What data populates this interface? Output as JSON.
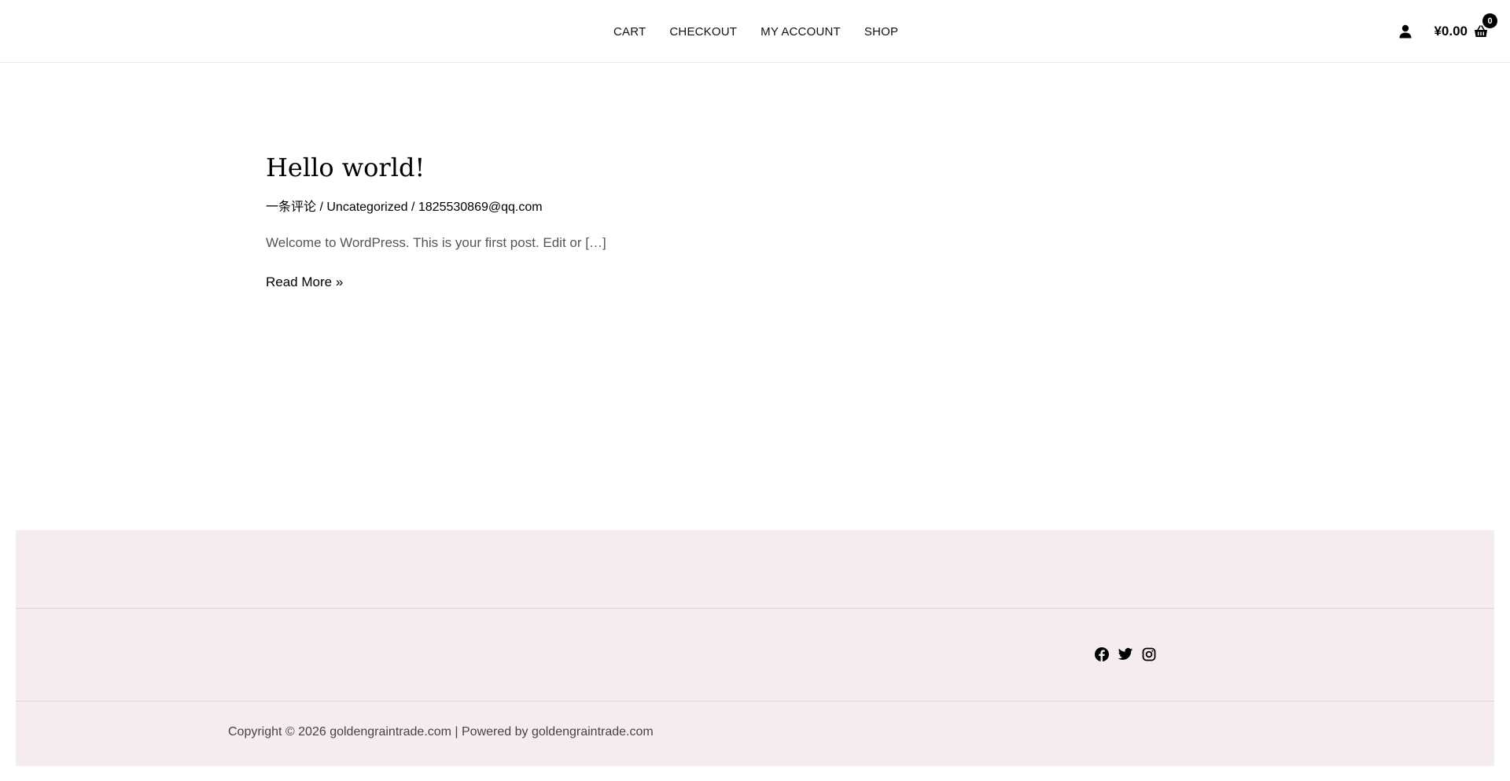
{
  "header": {
    "nav": {
      "cart": "CART",
      "checkout": "CHECKOUT",
      "my_account": "MY ACCOUNT",
      "shop": "SHOP"
    },
    "cart_total": "¥0.00",
    "cart_count": "0",
    "account_icon": "user-icon",
    "cart_icon": "shopping-basket-icon"
  },
  "post": {
    "title": "Hello world!",
    "meta": {
      "comments": "一条评论",
      "separator": " / ",
      "category": "Uncategorized",
      "author": "1825530869@qq.com"
    },
    "excerpt": "Welcome to WordPress. This is your first post. Edit or […]",
    "read_more": "Read More »"
  },
  "footer": {
    "social": [
      "facebook-icon",
      "twitter-icon",
      "instagram-icon"
    ],
    "copyright": "Copyright © 2026 goldengraintrade.com | Powered by goldengraintrade.com",
    "background_color": "#f5ecf0"
  }
}
